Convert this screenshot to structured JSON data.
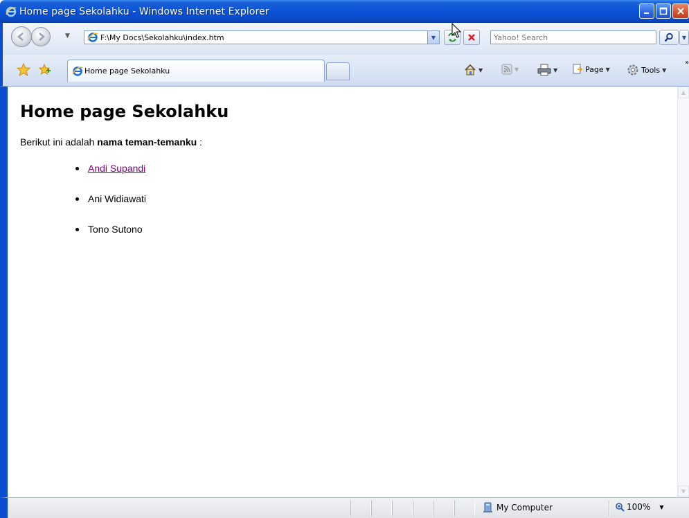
{
  "window": {
    "title": "Home page Sekolahku - Windows Internet Explorer"
  },
  "address_bar": {
    "url": "F:\\My Docs\\Sekolahku\\index.htm"
  },
  "search": {
    "placeholder": "Yahoo! Search"
  },
  "tabs": [
    {
      "label": "Home page Sekolahku",
      "active": true
    }
  ],
  "command_bar": {
    "page_label": "Page",
    "tools_label": "Tools"
  },
  "page": {
    "heading": "Home page Sekolahku",
    "intro_prefix": "Berikut ini adalah ",
    "intro_bold": "nama teman-temanku",
    "intro_suffix": " :",
    "friends": [
      {
        "name": "Andi Supandi",
        "is_link": true
      },
      {
        "name": "Ani Widiawati",
        "is_link": false
      },
      {
        "name": "Tono Sutono",
        "is_link": false
      }
    ]
  },
  "status_bar": {
    "zone": "My Computer",
    "zoom": "100%"
  },
  "colors": {
    "title_bar": "#0a53d8",
    "visited_link": "#800080"
  }
}
